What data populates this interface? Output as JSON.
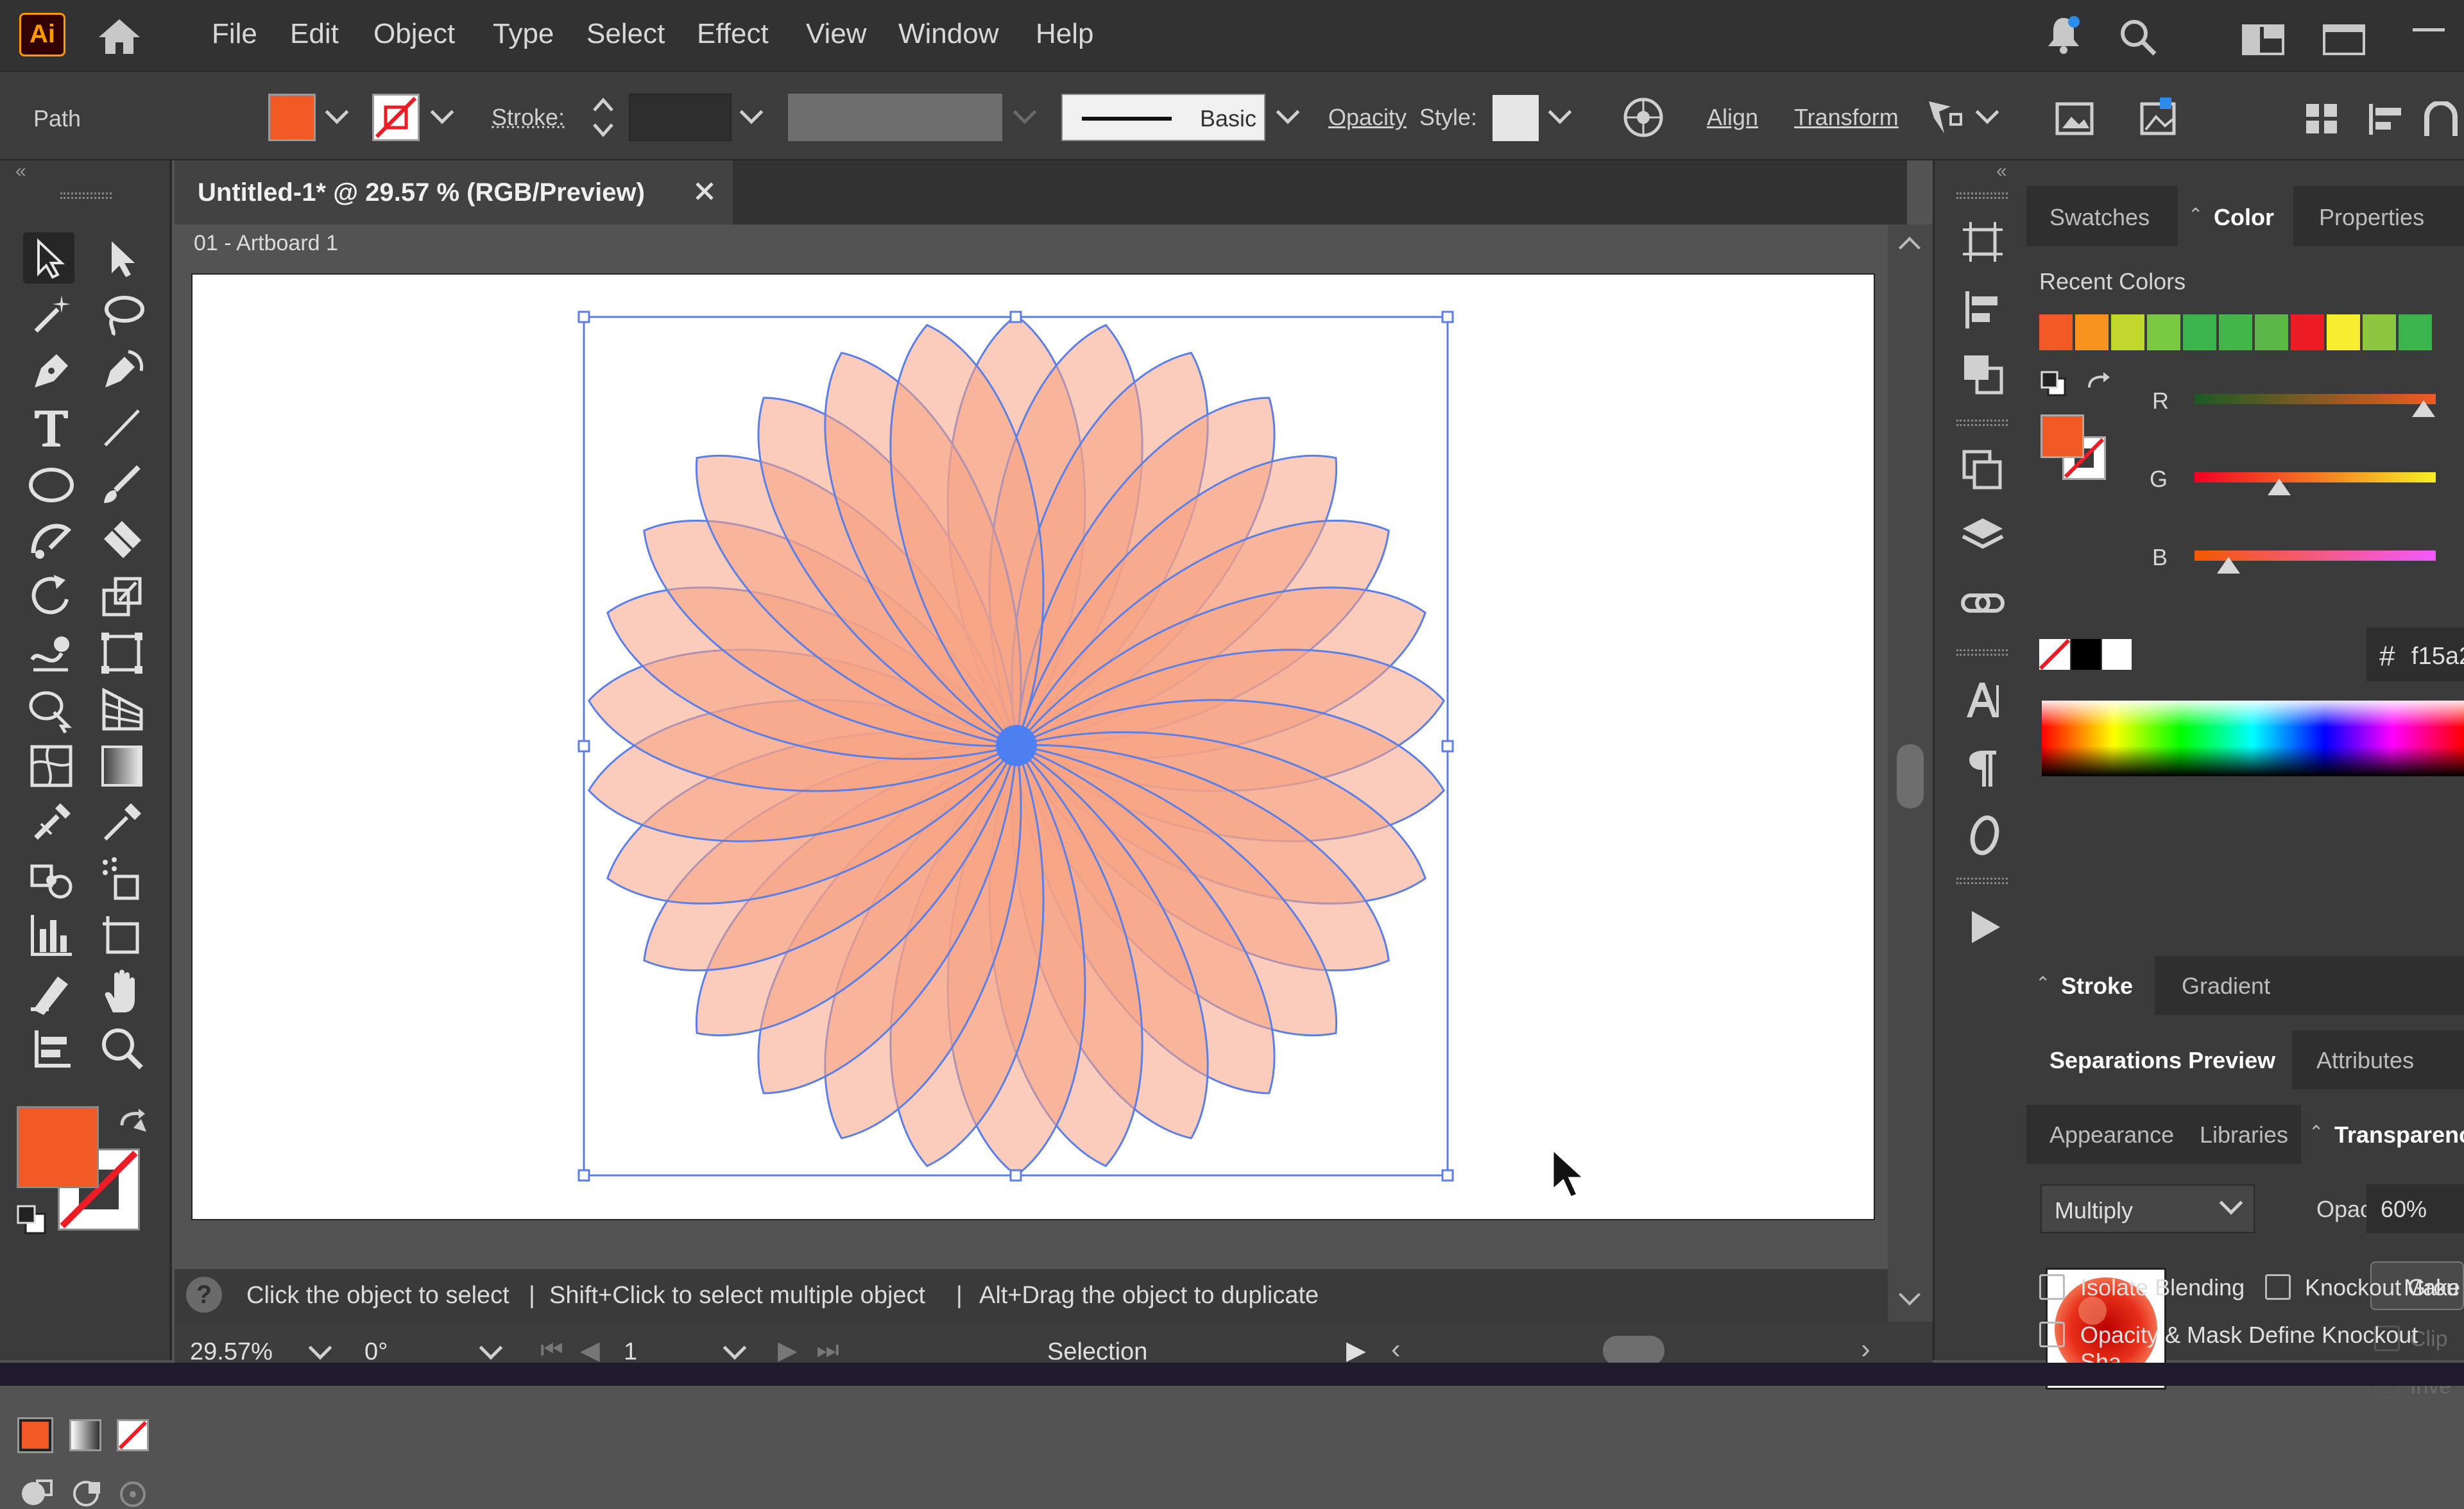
{
  "menubar": {
    "logo": "Ai",
    "items": [
      "File",
      "Edit",
      "Object",
      "Type",
      "Select",
      "Effect",
      "View",
      "Window",
      "Help"
    ]
  },
  "controlbar": {
    "selection_type": "Path",
    "stroke_label": "Stroke:",
    "brush_label": "Basic",
    "opacity_label": "Opacity",
    "style_label": "Style:",
    "align_label": "Align",
    "transform_label": "Transform",
    "fill_color": "#f15a24"
  },
  "document": {
    "tab_title": "Untitled-1* @ 29.57 % (RGB/Preview)",
    "artboard_label": "01 - Artboard 1"
  },
  "status": {
    "hint_1": "Click the object to select",
    "hint_2": "Shift+Click to select multiple object",
    "hint_3": "Alt+Drag the object to duplicate",
    "separator": "|",
    "zoom": "29.57%",
    "rotation": "0°",
    "artboard_number": "1",
    "current_tool": "Selection"
  },
  "color_panel": {
    "tabs": [
      "Swatches",
      "Color",
      "Properties"
    ],
    "active_tab": "Color",
    "recent_colors_label": "Recent Colors",
    "recent_colors": [
      "#f15a24",
      "#f7931e",
      "#c1d82f",
      "#7ac943",
      "#39b54a",
      "#42b649",
      "#5cb846",
      "#ed1c24",
      "#f9ed32",
      "#8dc63f",
      "#39b54a",
      "#22b14c"
    ],
    "channels": [
      {
        "label": "R",
        "level": 0.95
      },
      {
        "label": "G",
        "level": 0.35
      },
      {
        "label": "B",
        "level": 0.14
      }
    ],
    "hex_symbol": "#",
    "hex_value": "f15a2"
  },
  "stroke_panel": {
    "tabs": [
      "Stroke",
      "Gradient"
    ],
    "active_tab": "Stroke"
  },
  "separations_panel": {
    "tabs": [
      "Separations Preview",
      "Attributes"
    ],
    "active_tab": "Separations Preview"
  },
  "transparency_panel": {
    "tabs": [
      "Appearance",
      "Libraries",
      "Transparenc"
    ],
    "active_tab": "Transparenc",
    "blend_mode": "Multiply",
    "opacity_label": "Opacity:",
    "opacity_value": "60%",
    "make_button": "Make",
    "clip_label": "Clip",
    "invert_label": "Inve",
    "isolate_blending": "Isolate Blending",
    "knockout_group": "Knockout Grou",
    "opacity_mask_label": "Opacity & Mask Define Knockout Sha"
  },
  "colors": {
    "orange": "#f15a24",
    "selection_blue": "#5b7fe6"
  }
}
